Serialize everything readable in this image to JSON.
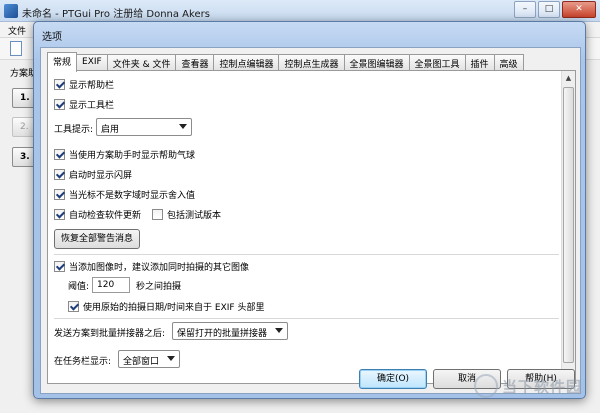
{
  "main_window": {
    "title": "未命名 - PTGui Pro 注册给 Donna Akers",
    "menu_first": "文件",
    "project_tab_label": "方案助",
    "step_buttons": [
      "1.",
      "2.",
      "3. "
    ]
  },
  "dialog": {
    "title": "选项",
    "tabs": [
      "常规",
      "EXIF",
      "文件夹 & 文件",
      "查看器",
      "控制点编辑器",
      "控制点生成器",
      "全景图编辑器",
      "全景图工具",
      "插件",
      "高级"
    ],
    "active_tab": "常规",
    "general": {
      "show_help_bar": {
        "label": "显示帮助栏",
        "checked": true
      },
      "show_toolbar": {
        "label": "显示工具栏",
        "checked": true
      },
      "tooltips": {
        "label": "工具提示:",
        "value": "启用"
      },
      "show_help_bubbles": {
        "label": "当使用方案助手时显示帮助气球",
        "checked": true
      },
      "show_splash": {
        "label": "启动时显示闪屏",
        "checked": true
      },
      "show_rounded_values": {
        "label": "当光标不是数字域时显示舍入值",
        "checked": true
      },
      "auto_check_updates": {
        "label": "自动检查软件更新",
        "checked": true
      },
      "include_beta": {
        "label": "包括测试版本",
        "checked": false
      },
      "restore_warnings_button": "恢复全部警告消息",
      "suggest_group": {
        "label": "当添加图像时，建议添加同时拍摄的其它图像",
        "checked": true
      },
      "threshold_label": "阈值:",
      "threshold_value": "120",
      "threshold_unit": "秒之间拍摄",
      "use_exif_date": {
        "label": "使用原始的拍摄日期/时间来自于 EXIF 头部里",
        "checked": true
      },
      "send_to_batch": {
        "label": "发送方案到批量拼接器之后:",
        "value": "保留打开的批量拼接器"
      },
      "taskbar_display": {
        "label": "在任务栏显示:",
        "value": "全部窗口"
      }
    },
    "ok_button": "确定(O)",
    "cancel_button": "取消",
    "help_button": "帮助(H)"
  },
  "watermark": {
    "text": "当下软件园"
  }
}
